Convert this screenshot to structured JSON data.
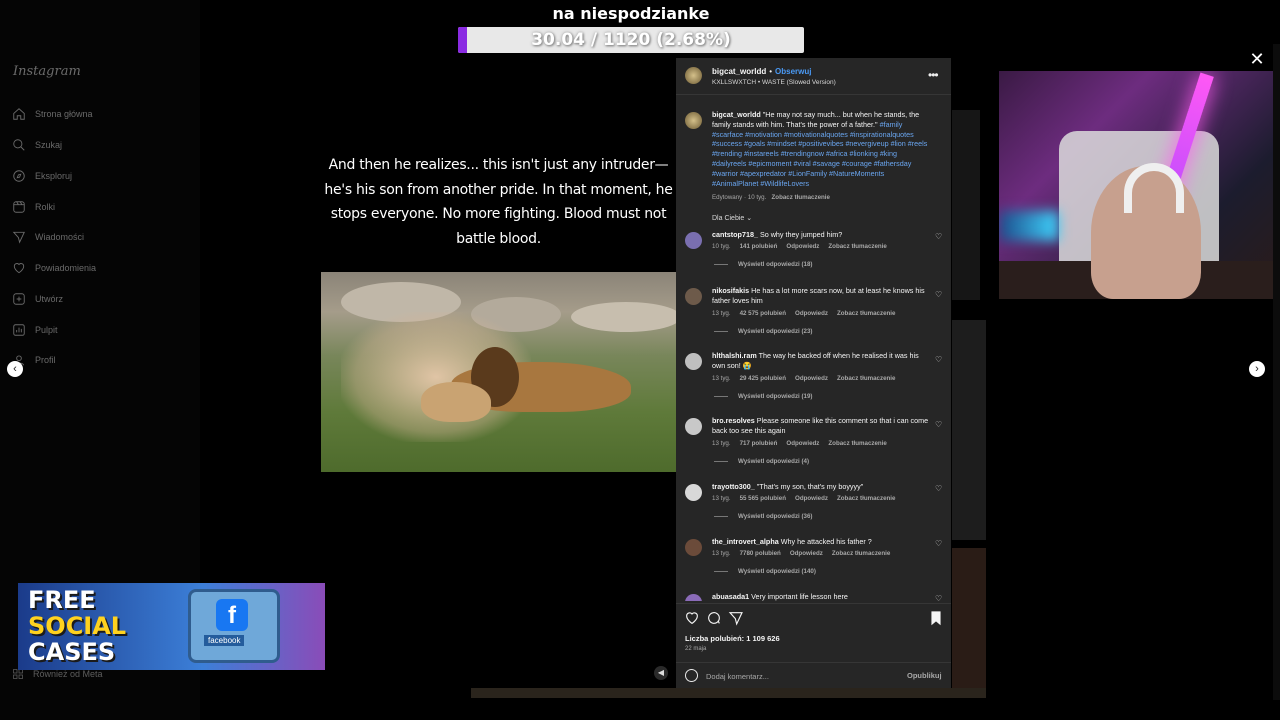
{
  "stream": {
    "title": "na niespodzianke",
    "progress_text": "30.04 / 1120 (2.68%)",
    "progress_fraction": 0.0268,
    "bar_color": "#8a2be2"
  },
  "sidebar": {
    "logo": "Instagram",
    "items": [
      {
        "label": "Strona główna",
        "icon": "home-icon"
      },
      {
        "label": "Szukaj",
        "icon": "search-icon"
      },
      {
        "label": "Eksploruj",
        "icon": "compass-icon"
      },
      {
        "label": "Rolki",
        "icon": "reels-icon"
      },
      {
        "label": "Wiadomości",
        "icon": "messenger-icon"
      },
      {
        "label": "Powiadomienia",
        "icon": "heart-icon"
      },
      {
        "label": "Utwórz",
        "icon": "plus-square-icon"
      },
      {
        "label": "Pulpit",
        "icon": "dashboard-icon"
      },
      {
        "label": "Profil",
        "icon": "profile-icon"
      }
    ],
    "meta_label": "Również od Meta"
  },
  "reel": {
    "caption": "And then he realizes... this isn't just any intruder—he's his son from another pride. In that moment, he stops everyone. No more fighting. Blood must not battle blood."
  },
  "ad": {
    "line1": "FREE",
    "line2": "SOCIAL",
    "line3": "CASES",
    "badge": "facebook"
  },
  "post": {
    "username": "bigcat_worldd",
    "follow_label": "Obserwuj",
    "song": "KXLLSWXTCH • WASTE (Slowed Version)",
    "caption_user": "bigcat_worldd",
    "caption_text": "\"He may not say much... but when he stands, the family stands with him. That's the power of a father.\"",
    "hashtags": "#family #scarface #motivation #motivationalquotes #inspirationalquotes #success #goals #mindset #positivevibes #nevergiveup #lion #reels #trending #instareels #trendingnow #africa #lionking #king #dailyreels #epicmoment #viral #savage #courage #fathersday #warrior #apexpredator #LionFamily #NatureMoments #AnimalPlanet #WildlifeLovers",
    "caption_meta": "Edytowany · 10 tyg.",
    "caption_translate": "Zobacz tłumaczenie",
    "for_you": "Dla Ciebie",
    "likes": "Liczba polubień: 1 109 626",
    "date": "22 maja",
    "comment_placeholder": "Dodaj komentarz...",
    "publish_label": "Opublikuj"
  },
  "comments": [
    {
      "user": "cantstop718_",
      "text": "So why they jumped him?",
      "age": "10 tyg.",
      "likes": "141 polubień",
      "reply": "Odpowiedz",
      "translate": "Zobacz tłumaczenie",
      "replies": "Wyświetl odpowiedzi (18)"
    },
    {
      "user": "nikosifakis",
      "text": "He has a lot more scars now, but at least he knows his father loves him",
      "age": "13 tyg.",
      "likes": "42 575 polubień",
      "reply": "Odpowiedz",
      "translate": "Zobacz tłumaczenie",
      "replies": "Wyświetl odpowiedzi (23)"
    },
    {
      "user": "hlthalshi.ram",
      "text": "The way he backed off when he realised it was his own son! 😭",
      "age": "13 tyg.",
      "likes": "29 425 polubień",
      "reply": "Odpowiedz",
      "translate": "Zobacz tłumaczenie",
      "replies": "Wyświetl odpowiedzi (19)"
    },
    {
      "user": "bro.resolves",
      "text": "Please someone like this comment so that i can come back too see this again",
      "age": "13 tyg.",
      "likes": "717 polubień",
      "reply": "Odpowiedz",
      "translate": "Zobacz tłumaczenie",
      "replies": "Wyświetl odpowiedzi (4)"
    },
    {
      "user": "trayotto300_",
      "text": "\"That's my son, that's my boyyyy\"",
      "age": "13 tyg.",
      "likes": "55 565 polubień",
      "reply": "Odpowiedz",
      "translate": "Zobacz tłumaczenie",
      "replies": "Wyświetl odpowiedzi (36)"
    },
    {
      "user": "the_introvert_alpha",
      "text": "Why he attacked his father ?",
      "age": "13 tyg.",
      "likes": "7780 polubień",
      "reply": "Odpowiedz",
      "translate": "Zobacz tłumaczenie",
      "replies": "Wyświetl odpowiedzi (140)"
    },
    {
      "user": "abuasada1",
      "text": "Very important life lesson here",
      "age": "",
      "likes": "",
      "reply": "",
      "translate": "",
      "replies": ""
    }
  ],
  "colors": {
    "panel_bg": "#262626",
    "link_blue": "#4a9af5",
    "hashtag_blue": "#6aa6f0"
  }
}
